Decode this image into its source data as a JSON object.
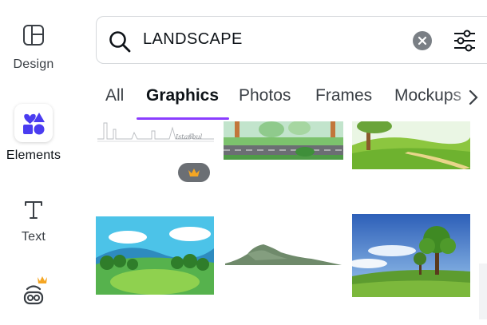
{
  "sidebar": {
    "items": [
      {
        "label": "Design",
        "icon": "design-layout-icon"
      },
      {
        "label": "Elements",
        "icon": "elements-shapes-icon",
        "selected": true
      },
      {
        "label": "Text",
        "icon": "text-t-icon"
      },
      {
        "label": "",
        "icon": "apps-icon",
        "premium": true
      }
    ]
  },
  "search": {
    "value": "LANDSCAPE",
    "placeholder": "",
    "clear_icon": "clear-x-icon",
    "filter_icon": "filter-sliders-icon"
  },
  "tabs": [
    {
      "label": "All"
    },
    {
      "label": "Graphics",
      "active": true
    },
    {
      "label": "Photos"
    },
    {
      "label": "Frames"
    },
    {
      "label": "Mockups"
    }
  ],
  "results": {
    "items": [
      {
        "kind": "sketch-skyline",
        "caption": "Istanbul",
        "premium": true
      },
      {
        "kind": "park-road"
      },
      {
        "kind": "hills-tree-road"
      },
      {
        "kind": "meadow-trees"
      },
      {
        "kind": "mountain-watercolor"
      },
      {
        "kind": "field-tree-photo"
      }
    ]
  },
  "colors": {
    "accent": "#8b3dff",
    "elements_icon": "#4a3cf0",
    "crown": "#f5a623"
  }
}
